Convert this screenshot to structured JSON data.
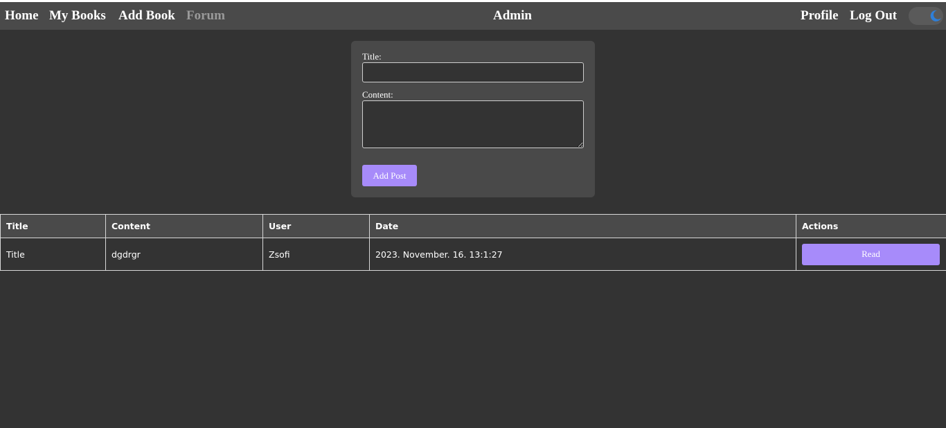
{
  "nav": {
    "left_links": [
      {
        "label": "Home"
      },
      {
        "label": "My Books"
      },
      {
        "label": "Add Book"
      },
      {
        "label": "Forum",
        "active": true
      }
    ],
    "center_title": "Admin",
    "right_links": [
      {
        "label": "Profile"
      },
      {
        "label": "Log Out"
      }
    ],
    "theme_toggle": {
      "icon": "moon-icon",
      "state": "dark"
    }
  },
  "post_form": {
    "title_label": "Title:",
    "title_value": "",
    "content_label": "Content:",
    "content_value": "",
    "submit_label": "Add Post"
  },
  "posts_table": {
    "columns": [
      "Title",
      "Content",
      "User",
      "Date",
      "Actions"
    ],
    "rows": [
      {
        "title": "Title",
        "content": "dgdrgr",
        "user": "Zsofi",
        "date": "2023. November. 16. 13:1:27",
        "action_label": "Read"
      }
    ]
  },
  "colors": {
    "background": "#333333",
    "navbar": "#4a4a4a",
    "card": "#494949",
    "accent": "#a78bfa",
    "muted_link": "#9a9a9a",
    "moon": "#2f7fd8"
  }
}
